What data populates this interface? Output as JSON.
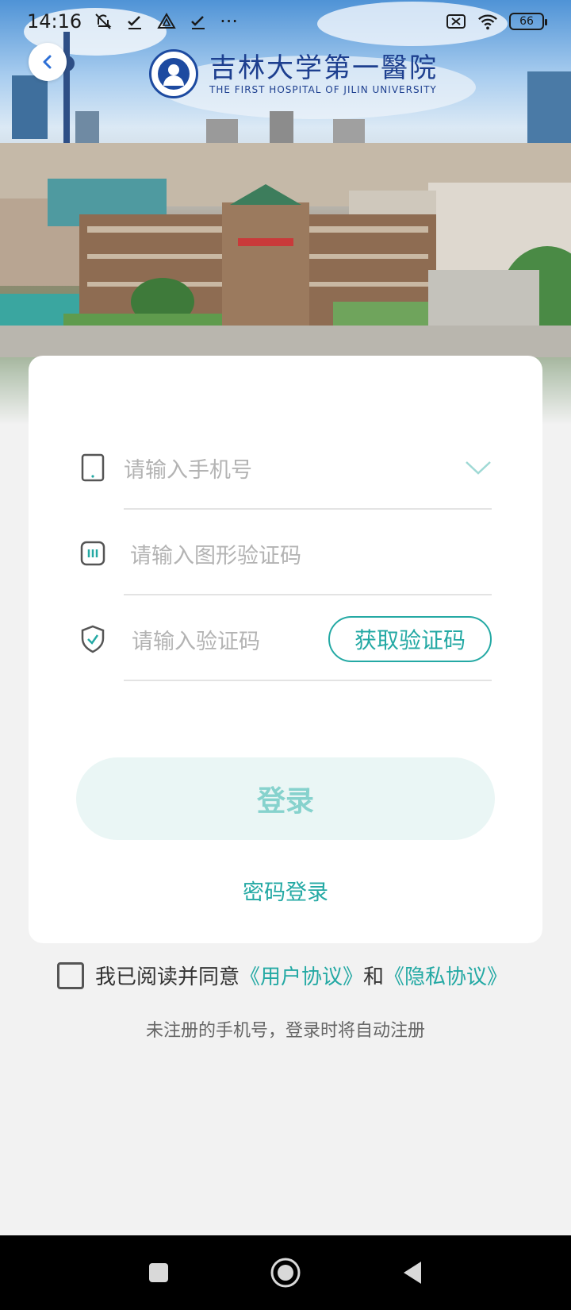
{
  "status_bar": {
    "time": "14:16",
    "battery": "66",
    "more": "···"
  },
  "header": {
    "logo_cn": "吉林大学第一醫院",
    "logo_en": "THE FIRST HOSPITAL OF JILIN UNIVERSITY"
  },
  "form": {
    "phone_placeholder": "请输入手机号",
    "captcha_placeholder": "请输入图形验证码",
    "code_placeholder": "请输入验证码",
    "get_code_label": "获取验证码",
    "login_label": "登录",
    "password_login_label": "密码登录"
  },
  "agreement": {
    "prefix": "我已阅读并同意",
    "user_agreement": "《用户协议》",
    "and": "和",
    "privacy_agreement": "《隐私协议》",
    "checked": false
  },
  "note": "未注册的手机号，登录时将自动注册",
  "colors": {
    "accent": "#24a9a4",
    "login_bg": "#eaf6f5",
    "login_text": "#86d2cd",
    "page_bg": "#f2f2f2"
  }
}
